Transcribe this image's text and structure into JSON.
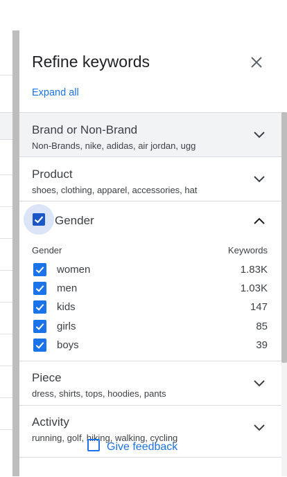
{
  "panel": {
    "title": "Refine keywords",
    "expand_all": "Expand all",
    "feedback": "Give feedback"
  },
  "sections": [
    {
      "title": "Brand or Non-Brand",
      "subtitle": "Non-Brands, nike, adidas, air jordan, ugg",
      "expanded": false
    },
    {
      "title": "Product",
      "subtitle": "shoes, clothing, apparel, accessories, hat",
      "expanded": false
    },
    {
      "title": "Gender",
      "expanded": true,
      "checked": true,
      "col_left": "Gender",
      "col_right": "Keywords",
      "items": [
        {
          "label": "women",
          "count": "1.83K",
          "checked": true
        },
        {
          "label": "men",
          "count": "1.03K",
          "checked": true
        },
        {
          "label": "kids",
          "count": "147",
          "checked": true
        },
        {
          "label": "girls",
          "count": "85",
          "checked": true
        },
        {
          "label": "boys",
          "count": "39",
          "checked": true
        }
      ]
    },
    {
      "title": "Piece",
      "subtitle": "dress, shirts, tops, hoodies, pants",
      "expanded": false
    },
    {
      "title": "Activity",
      "subtitle": "running, golf, hiking, walking, cycling",
      "expanded": false
    }
  ],
  "colors": {
    "accent": "#1a73e8",
    "checkbox_dark": "#1a56c8",
    "section_gray": "#f1f3f4"
  }
}
